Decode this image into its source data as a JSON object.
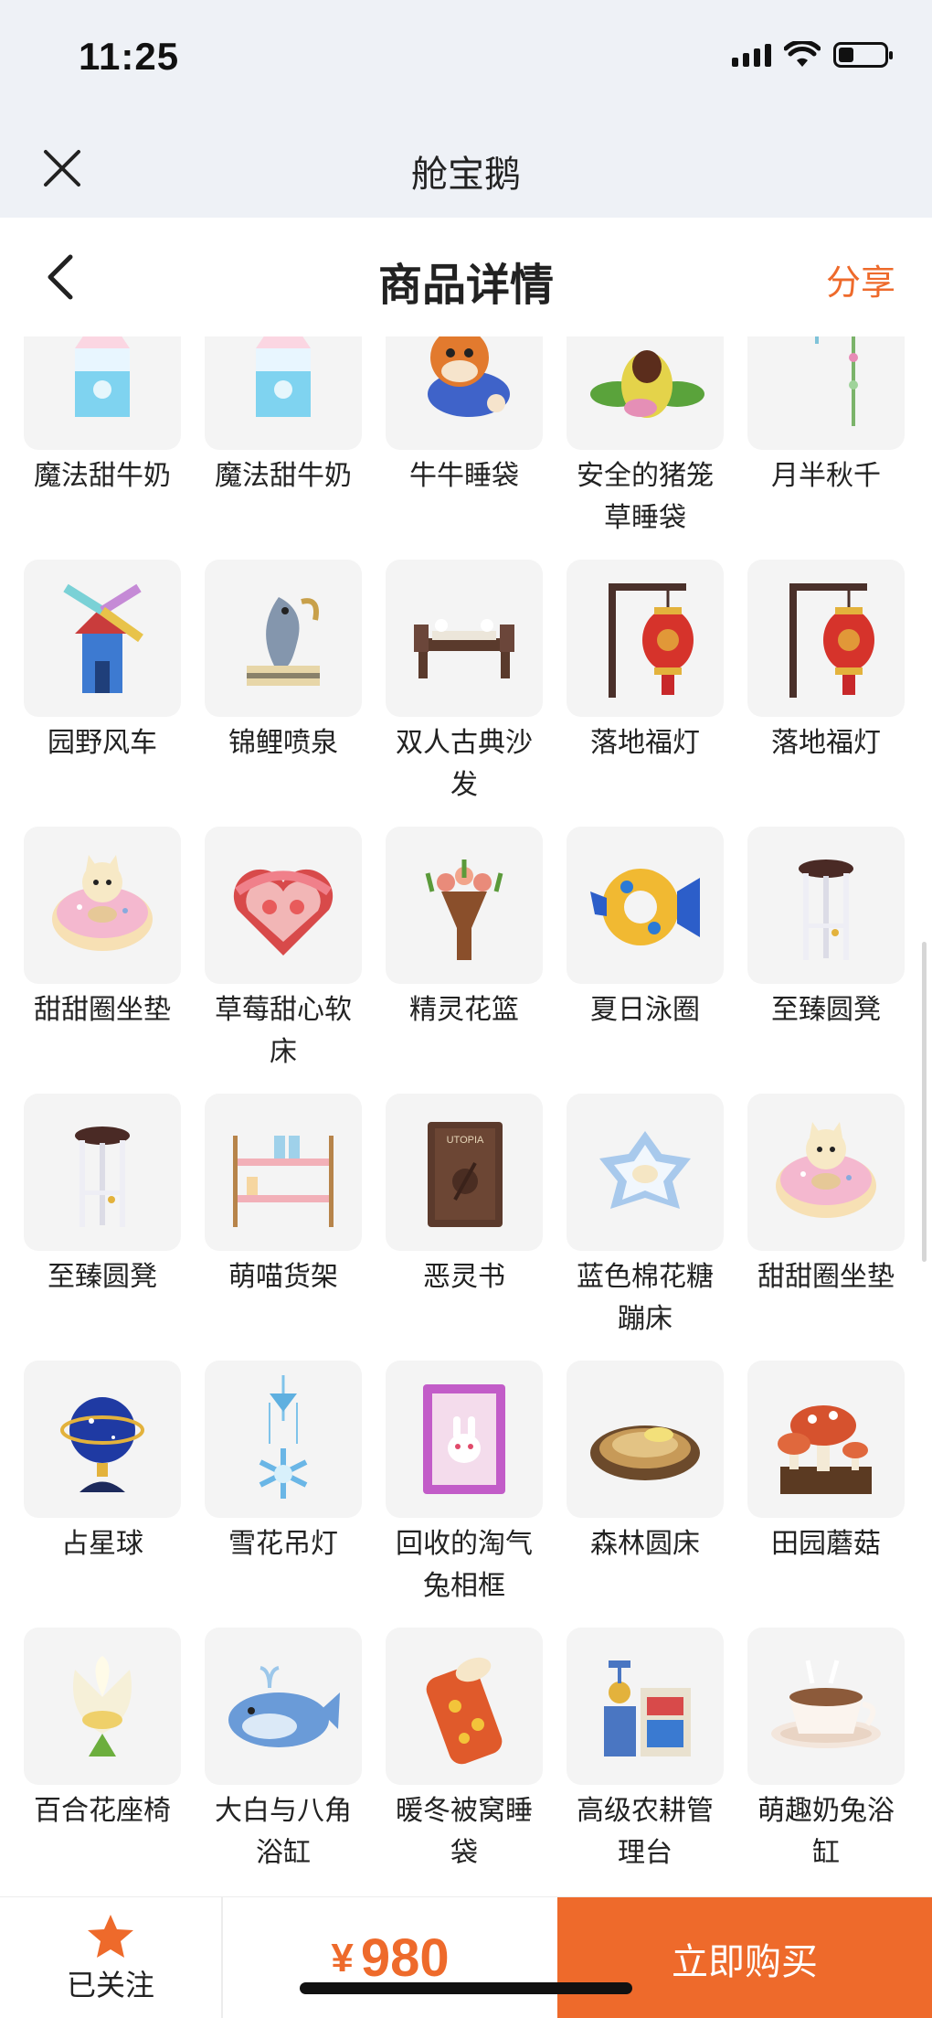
{
  "status_bar": {
    "time": "11:25",
    "battery_level": 0.3
  },
  "app_header": {
    "title": "舱宝鹅"
  },
  "nav": {
    "title": "商品详情",
    "share_label": "分享"
  },
  "grid": {
    "items": [
      {
        "label": "魔法甜牛奶",
        "icon": "milk-carton-icon"
      },
      {
        "label": "魔法甜牛奶",
        "icon": "milk-carton-icon"
      },
      {
        "label": "牛牛睡袋",
        "icon": "cow-sleeping-bag-icon"
      },
      {
        "label": "安全的猪笼草睡袋",
        "icon": "pitcher-plant-icon"
      },
      {
        "label": "月半秋千",
        "icon": "moon-swing-icon"
      },
      {
        "label": "园野风车",
        "icon": "windmill-icon"
      },
      {
        "label": "锦鲤喷泉",
        "icon": "koi-fountain-icon"
      },
      {
        "label": "双人古典沙发",
        "icon": "classic-sofa-icon"
      },
      {
        "label": "落地福灯",
        "icon": "lantern-icon"
      },
      {
        "label": "落地福灯",
        "icon": "lantern-icon"
      },
      {
        "label": "甜甜圈坐垫",
        "icon": "donut-cushion-icon"
      },
      {
        "label": "草莓甜心软床",
        "icon": "strawberry-heart-bed-icon"
      },
      {
        "label": "精灵花篮",
        "icon": "flower-basket-icon"
      },
      {
        "label": "夏日泳圈",
        "icon": "fish-swim-ring-icon"
      },
      {
        "label": "至臻圆凳",
        "icon": "round-stool-icon"
      },
      {
        "label": "至臻圆凳",
        "icon": "round-stool-icon"
      },
      {
        "label": "萌喵货架",
        "icon": "cat-shelf-icon"
      },
      {
        "label": "恶灵书",
        "icon": "evil-book-icon"
      },
      {
        "label": "蓝色棉花糖蹦床",
        "icon": "marshmallow-trampoline-icon"
      },
      {
        "label": "甜甜圈坐垫",
        "icon": "donut-cushion-icon"
      },
      {
        "label": "占星球",
        "icon": "astrology-globe-icon"
      },
      {
        "label": "雪花吊灯",
        "icon": "snowflake-chandelier-icon"
      },
      {
        "label": "回收的淘气兔相框",
        "icon": "bunny-frame-icon"
      },
      {
        "label": "森林圆床",
        "icon": "forest-round-bed-icon"
      },
      {
        "label": "田园蘑菇",
        "icon": "mushroom-icon"
      },
      {
        "label": "百合花座椅",
        "icon": "lily-chair-icon"
      },
      {
        "label": "大白与八角浴缸",
        "icon": "whale-bathtub-icon"
      },
      {
        "label": "暖冬被窝睡袋",
        "icon": "winter-sleeping-bag-icon"
      },
      {
        "label": "高级农耕管理台",
        "icon": "farm-console-icon"
      },
      {
        "label": "萌趣奶兔浴缸",
        "icon": "teacup-bathtub-icon"
      }
    ]
  },
  "bottom_bar": {
    "follow_label": "已关注",
    "price_symbol": "¥",
    "price_value": "980",
    "buy_label": "立即购买"
  },
  "colors": {
    "accent": "#ee6a2b",
    "header_bg": "#eef1f6",
    "tile_bg": "#f4f4f4"
  }
}
